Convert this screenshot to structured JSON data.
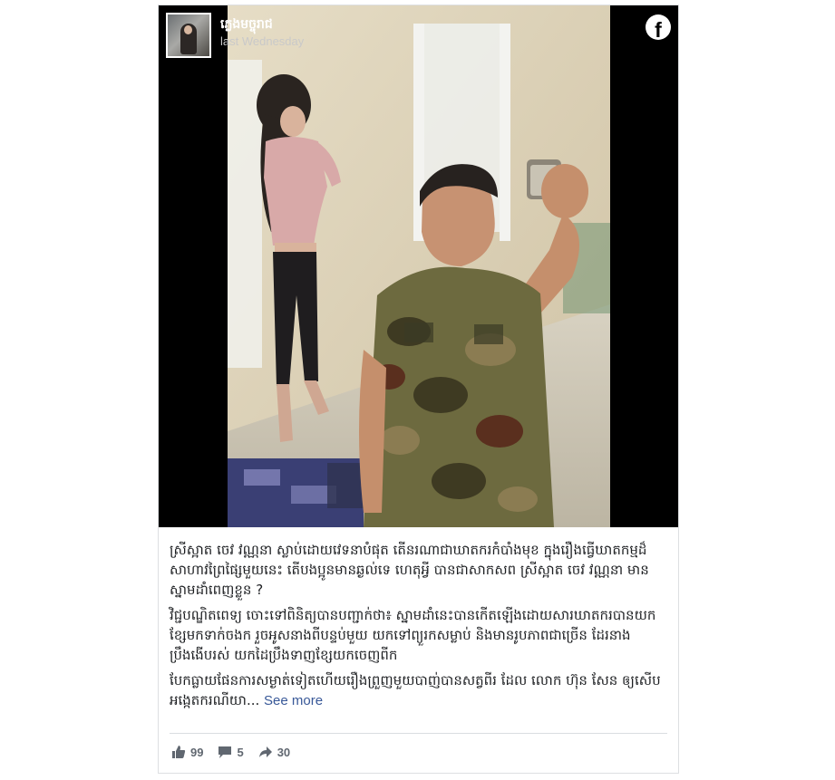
{
  "post": {
    "author": "ភ្លេងមច្ចុរាជ",
    "time": "last Wednesday",
    "platform_icon": "facebook-icon",
    "caption_paragraphs": [
      "ស្រីស្អាត ចេវ វណ្ណនា ស្លាប់ដោយវេទនាបំផុត តើនរណាជាឃាតករកំបាំងមុខ ក្នុងរឿងធ្វើឃាតកម្មដ៏សាហាវព្រៃផ្សៃមួយនេះ តើបងប្អូនមានឆ្ងល់ទេ ហេតុអ្វី បានជាសាកសព ស្រីស្អាត ចេវ វណ្ណនា មានស្នាមដាំពេញខ្លួន ?",
      "វិជ្ជបណ្ឌិតពេទ្យ ចោះទៅពិនិត្យបានបញ្ជាក់ថា៖ ស្នាមដាំនេះបានកើតឡើងដោយសារឃាតករបានយកខ្សែមកទាក់ចងក រួចអូសនាងពីបន្ទប់មួយ យកទៅព្យួរកសម្លាប់ និងមានរូបភាពជាច្រើន ដែរនាងប្រឹងងើបរស់ យកដៃប្រឹងទាញខ្សែយកចេញពីក",
      "បែកធ្លាយផែនការសម្ងាត់ទៀតហើយរឿងព្រួញមួយបាញ់បានសត្វពីរ ដែល លោក ហ៊ុន សែន ឲ្យសើបអង្កេតករណីយា..."
    ],
    "see_more": "See more",
    "stats": {
      "likes": "99",
      "comments": "5",
      "shares": "30"
    }
  },
  "colors": {
    "media_bg": "#000000",
    "link": "#385898",
    "text": "#1c1e21",
    "muted": "#606770"
  }
}
